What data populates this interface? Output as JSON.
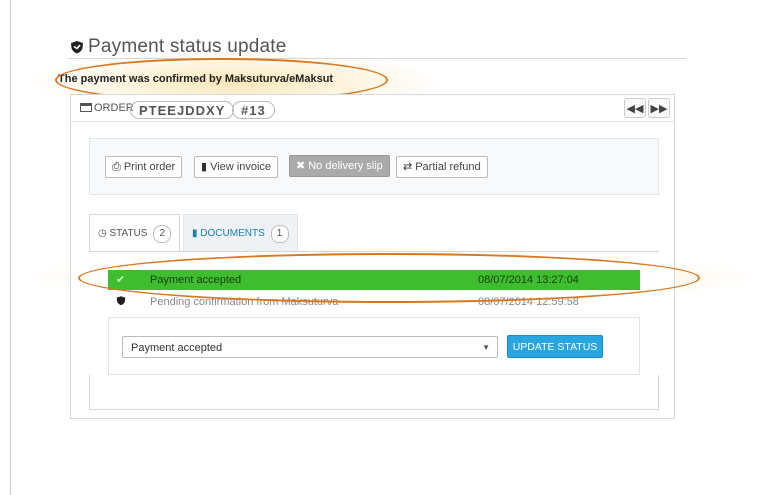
{
  "page": {
    "title": "Payment status update",
    "confirmation": "The payment was confirmed by Maksuturva/eMaksut"
  },
  "order": {
    "label": "ORDER",
    "reference": "PTEEJDDXY",
    "number": "#13"
  },
  "actions": {
    "print_order": "Print order",
    "view_invoice": "View invoice",
    "no_delivery_slip": "No delivery slip",
    "partial_refund": "Partial refund"
  },
  "tabs": [
    {
      "label": "STATUS",
      "count": "2"
    },
    {
      "label": "DOCUMENTS",
      "count": "1"
    }
  ],
  "history": [
    {
      "status": "Payment accepted",
      "date": "08/07/2014 13:27:04",
      "icon": "check-icon",
      "color": "#3ebd2f"
    },
    {
      "status": "Pending confirmation from Maksuturva",
      "date": "08/07/2014 12:59:58",
      "icon": "shield-icon",
      "color": "#ffffff"
    }
  ],
  "status_form": {
    "selected": "Payment accepted",
    "button": "UPDATE STATUS"
  },
  "colors": {
    "accent": "#29a6e0",
    "highlight": "#d9781e",
    "accepted_row": "#3ebd2f"
  }
}
